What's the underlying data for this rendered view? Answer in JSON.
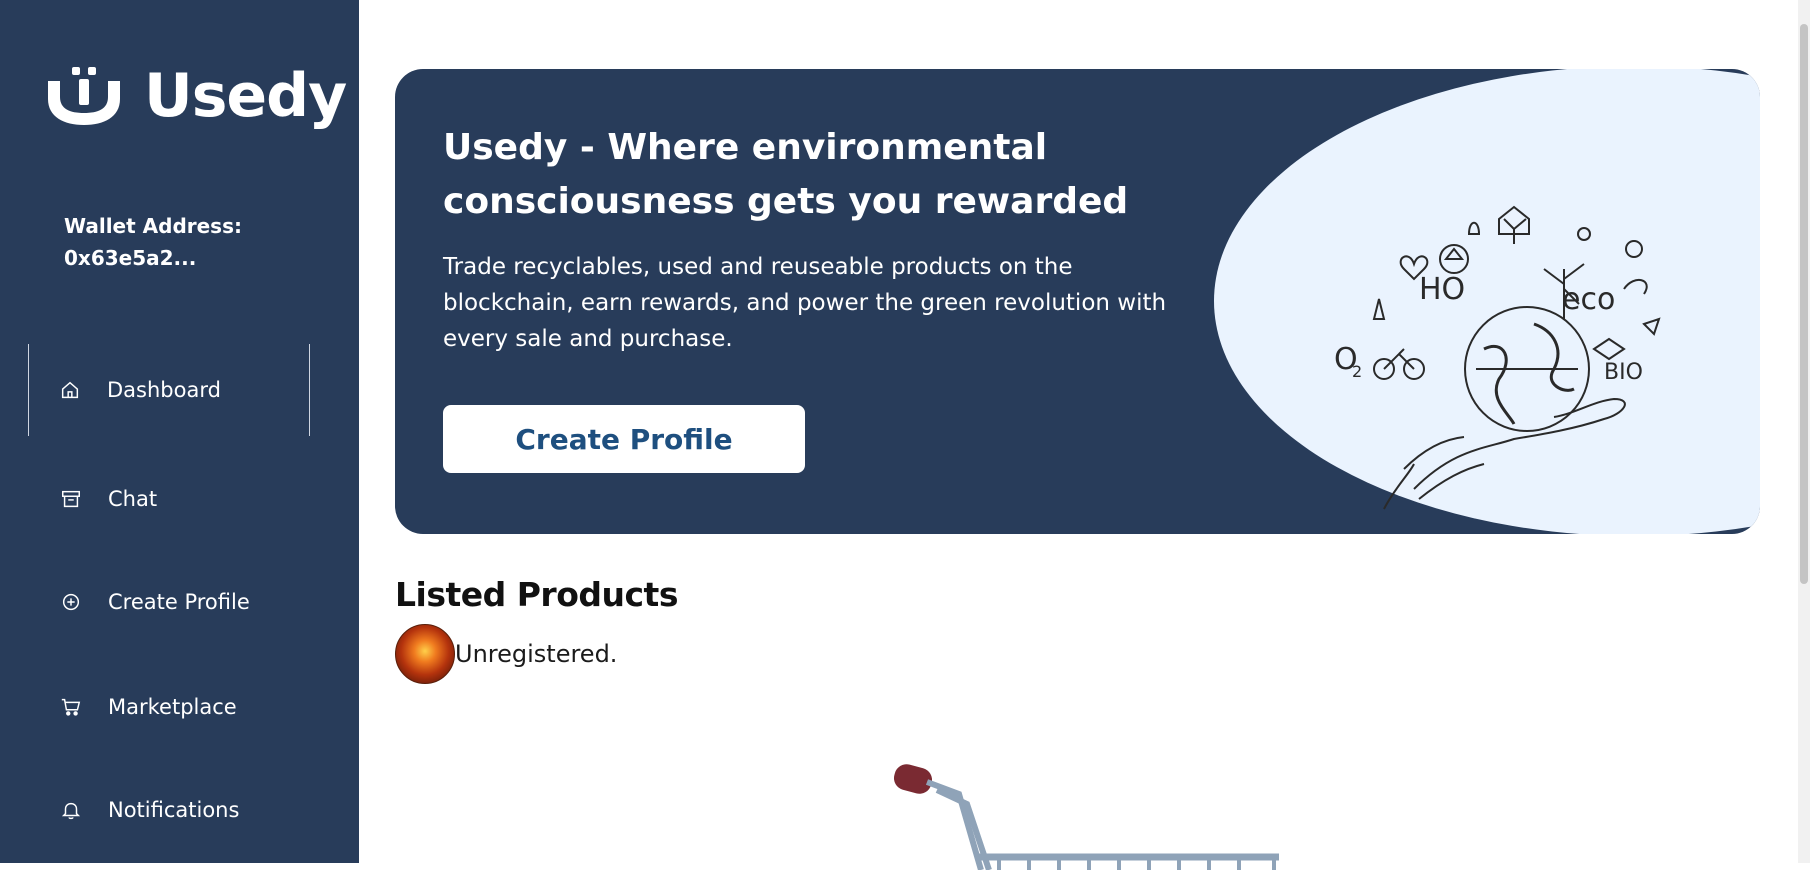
{
  "brand": {
    "name": "Usedy"
  },
  "wallet": {
    "label": "Wallet Address:",
    "value": "0x63e5a2..."
  },
  "nav": {
    "items": [
      {
        "label": "Dashboard",
        "icon": "home-icon",
        "active": true
      },
      {
        "label": "Chat",
        "icon": "archive-icon",
        "active": false
      },
      {
        "label": "Create Profile",
        "icon": "plus-circle-icon",
        "active": false
      },
      {
        "label": "Marketplace",
        "icon": "cart-icon",
        "active": false
      },
      {
        "label": "Notifications",
        "icon": "bell-icon",
        "active": false
      }
    ]
  },
  "hero": {
    "title": "Usedy - Where environmental consciousness gets you rewarded",
    "description": "Trade recyclables, used and reuseable products on the blockchain, earn rewards, and power the green revolution with every sale and purchase.",
    "button_label": "Create Profile"
  },
  "listed": {
    "title": "Listed Products",
    "user_status": "Unregistered."
  },
  "colors": {
    "sidebar": "#283c5a",
    "hero": "#283c5a",
    "hero_art_bg": "#eaf3fe",
    "button_text": "#1e4f7f"
  }
}
